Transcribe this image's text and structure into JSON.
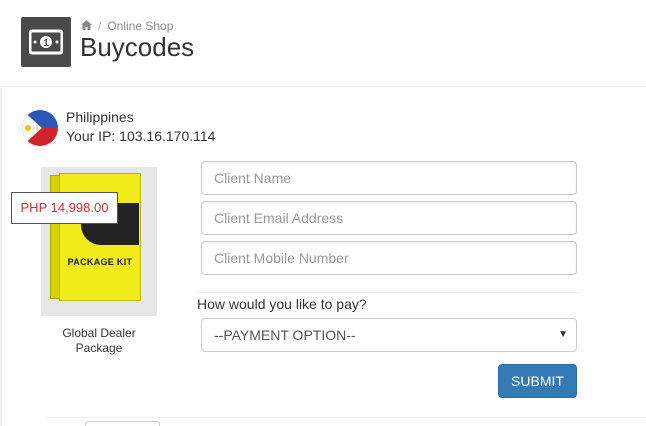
{
  "header": {
    "breadcrumb": {
      "home_icon": "home-icon",
      "separator": "/",
      "current": "Online Shop"
    },
    "title": "Buycodes",
    "app_icon": "money-bill-icon"
  },
  "location": {
    "country": "Philippines",
    "ip_text": "Your IP: 103.16.170.114",
    "flag_icon": "philippines-flag-icon"
  },
  "product": {
    "price": "PHP 14,998.00",
    "name": "Global Dealer Package",
    "image_text": "PACKAGE KIT",
    "price_color": "#c9302c"
  },
  "form": {
    "client_name_placeholder": "Client Name",
    "client_email_placeholder": "Client Email Address",
    "client_mobile_placeholder": "Client Mobile Number",
    "payment_label": "How would you like to pay?",
    "payment_selected": "--PAYMENT OPTION--",
    "submit_label": "SUBMIT",
    "accent_color": "#337ab7"
  }
}
